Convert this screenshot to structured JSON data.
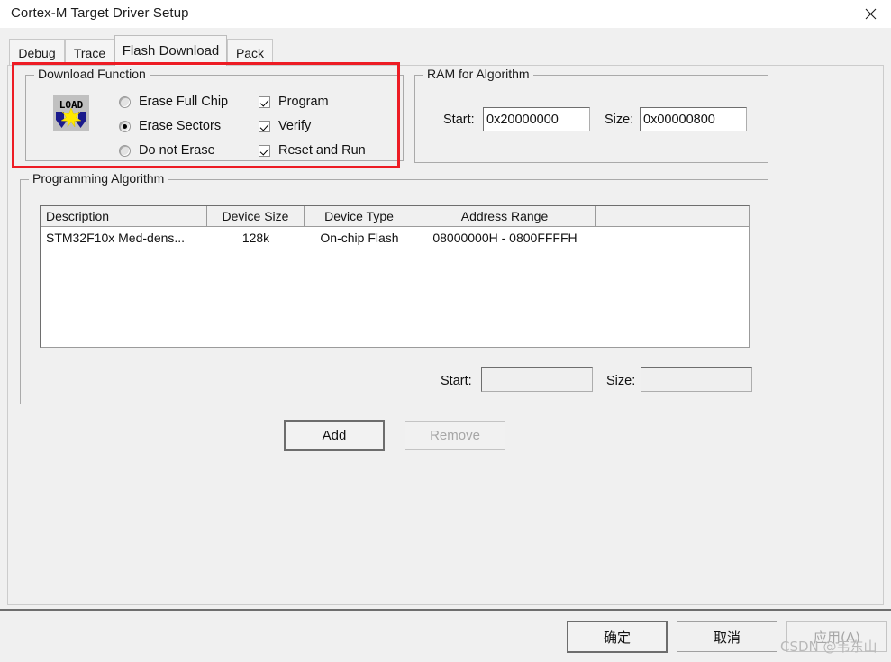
{
  "window": {
    "title": "Cortex-M Target Driver Setup",
    "close_icon": "close-icon"
  },
  "tabs": [
    {
      "label": "Debug",
      "active": false
    },
    {
      "label": "Trace",
      "active": false
    },
    {
      "label": "Flash Download",
      "active": true
    },
    {
      "label": "Pack",
      "active": false
    }
  ],
  "download_function": {
    "group_label": "Download Function",
    "icon": {
      "name": "load-icon",
      "text": "LOAD"
    },
    "erase_options": [
      {
        "label": "Erase Full Chip",
        "checked": false
      },
      {
        "label": "Erase Sectors",
        "checked": true
      },
      {
        "label": "Do not Erase",
        "checked": false
      }
    ],
    "checkboxes": [
      {
        "label": "Program",
        "checked": true
      },
      {
        "label": "Verify",
        "checked": true
      },
      {
        "label": "Reset and Run",
        "checked": true
      }
    ]
  },
  "ram_for_algorithm": {
    "group_label": "RAM for Algorithm",
    "start_label": "Start:",
    "start_value": "0x20000000",
    "size_label": "Size:",
    "size_value": "0x00000800"
  },
  "programming_algorithm": {
    "group_label": "Programming Algorithm",
    "columns": [
      "Description",
      "Device Size",
      "Device Type",
      "Address Range",
      ""
    ],
    "rows": [
      {
        "description": "STM32F10x Med-dens...",
        "device_size": "128k",
        "device_type": "On-chip Flash",
        "address_range": "08000000H - 0800FFFFH",
        "extra": ""
      }
    ],
    "start_label": "Start:",
    "start_value": "",
    "size_label": "Size:",
    "size_value": "",
    "add_button": "Add",
    "remove_button": "Remove"
  },
  "footer": {
    "ok_button": "确定",
    "cancel_button": "取消",
    "apply_button": "应用(A)"
  },
  "watermark": "CSDN @韦东山",
  "colors": {
    "highlight": "#ed1c24",
    "dialog_bg": "#f0f0f0",
    "field_bg": "#ffffff"
  }
}
